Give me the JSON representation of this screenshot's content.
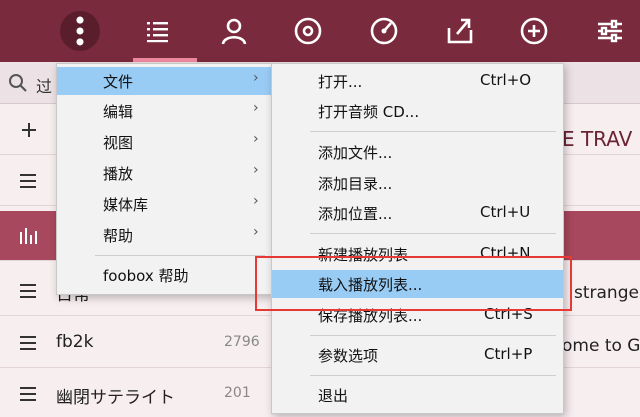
{
  "toolbar": {
    "buttons": [
      {
        "name": "menu-button",
        "icon": "vertical-dots-icon"
      },
      {
        "name": "playlist-button",
        "icon": "list-icon"
      },
      {
        "name": "artist-button",
        "icon": "person-icon"
      },
      {
        "name": "album-button",
        "icon": "disc-icon"
      },
      {
        "name": "genre-button",
        "icon": "gauge-icon"
      },
      {
        "name": "share-button",
        "icon": "share-icon"
      },
      {
        "name": "add-button",
        "icon": "plus-circle-icon"
      },
      {
        "name": "settings-button",
        "icon": "sliders-icon"
      }
    ],
    "bg_color": "#7a2a3d",
    "accent_color": "#f08aa0"
  },
  "search": {
    "partial_text": "过"
  },
  "playlists": [
    {
      "name": "",
      "count": "",
      "icon": "plus-icon"
    },
    {
      "name": "",
      "count": "",
      "icon": "list-icon"
    },
    {
      "name": "",
      "count": "",
      "icon": "playing-bars-icon",
      "active": true
    },
    {
      "name": "日常",
      "count": "",
      "icon": "list-icon"
    },
    {
      "name": "fb2k",
      "count": "2796",
      "icon": "list-icon"
    },
    {
      "name": "幽閉サテライト",
      "count": "201",
      "icon": "list-icon"
    }
  ],
  "right_panel": {
    "row1_text": "CE TRAV",
    "row4_text": "strange",
    "row5_text": "ome to G"
  },
  "main_menu": {
    "items": [
      {
        "label": "文件",
        "has_submenu": true,
        "highlighted": true
      },
      {
        "label": "编辑",
        "has_submenu": true
      },
      {
        "label": "视图",
        "has_submenu": true
      },
      {
        "label": "播放",
        "has_submenu": true
      },
      {
        "label": "媒体库",
        "has_submenu": true
      },
      {
        "label": "帮助",
        "has_submenu": true
      },
      {
        "label": "foobox 帮助",
        "has_submenu": false
      }
    ]
  },
  "file_menu": {
    "items": [
      {
        "label": "打开...",
        "shortcut": "Ctrl+O"
      },
      {
        "label": "打开音频 CD...",
        "shortcut": ""
      },
      {
        "label": "添加文件...",
        "shortcut": ""
      },
      {
        "label": "添加目录...",
        "shortcut": ""
      },
      {
        "label": "添加位置...",
        "shortcut": "Ctrl+U"
      },
      {
        "label": "新建播放列表",
        "shortcut": "Ctrl+N"
      },
      {
        "label": "载入播放列表...",
        "shortcut": "",
        "highlighted": true
      },
      {
        "label": "保存播放列表...",
        "shortcut": "Ctrl+S"
      },
      {
        "label": "参数选项",
        "shortcut": "Ctrl+P"
      },
      {
        "label": "退出",
        "shortcut": ""
      }
    ]
  },
  "highlight_color": "#99ccf5",
  "annotation_color": "#e53935"
}
